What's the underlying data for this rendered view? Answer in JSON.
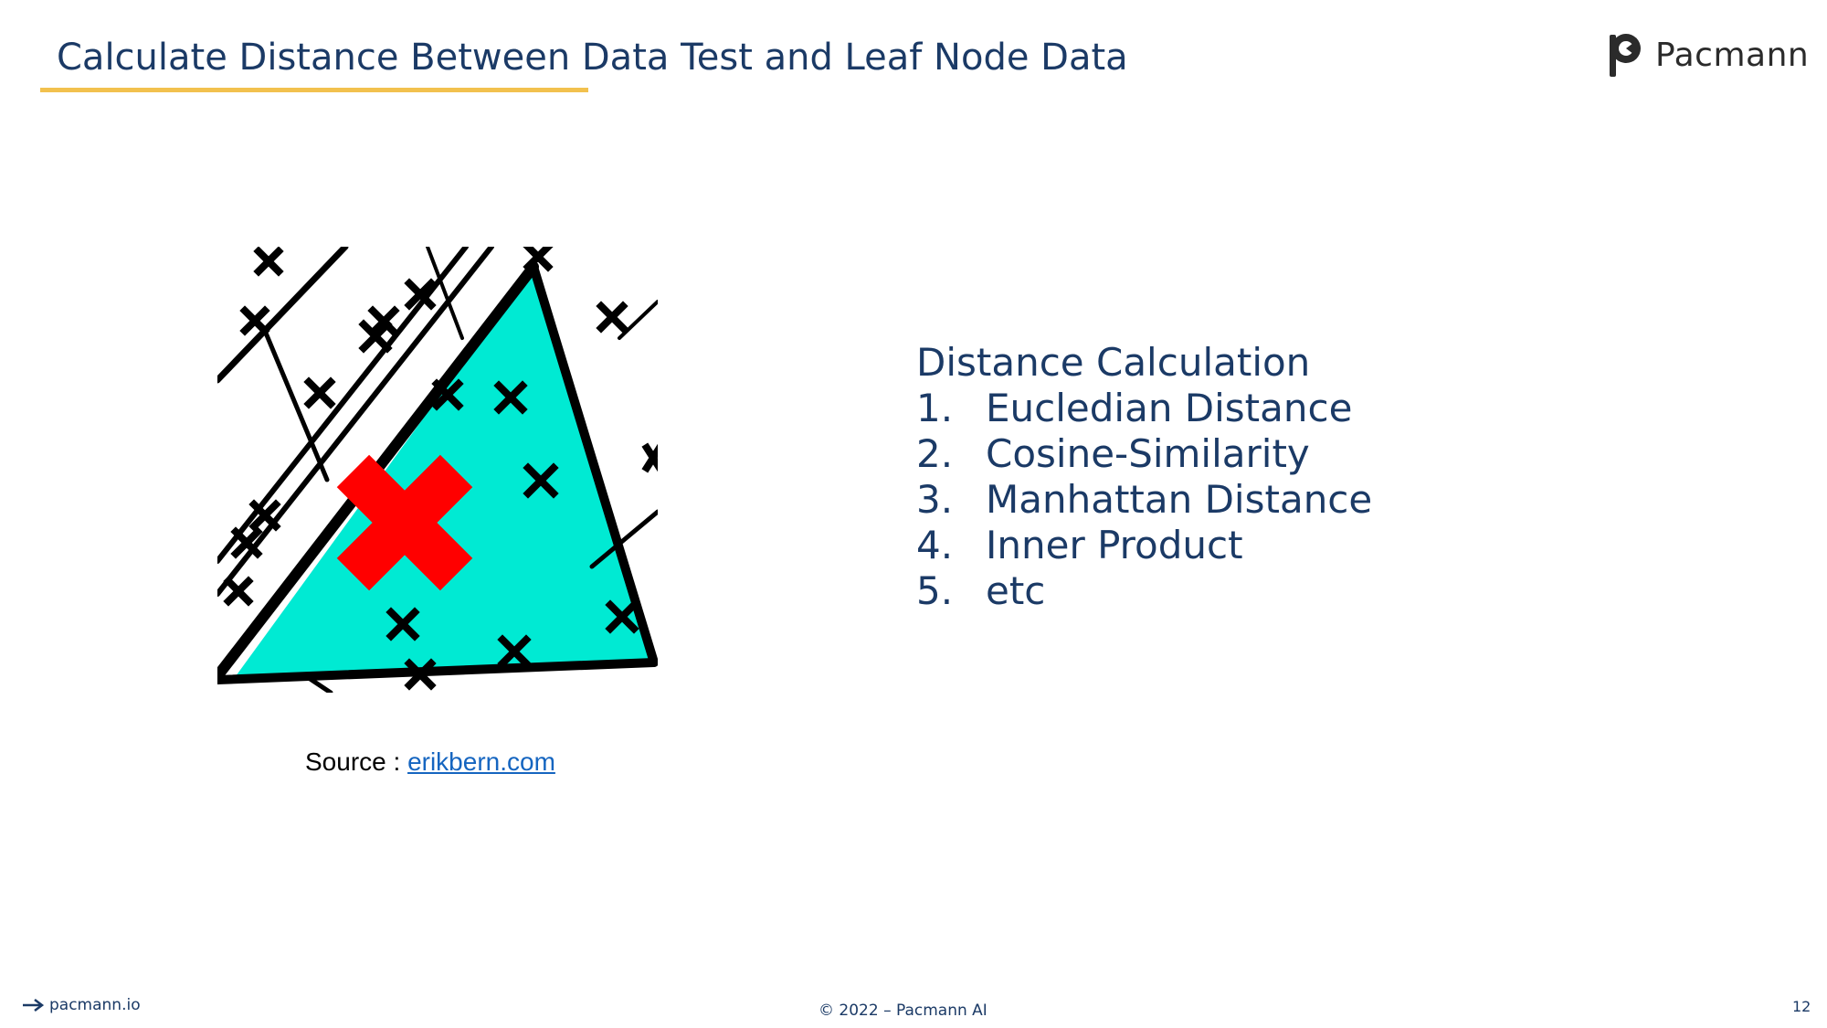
{
  "slide": {
    "title": "Calculate Distance Between Data Test and Leaf Node Data",
    "page_number": "12"
  },
  "brand": {
    "name": "Pacmann",
    "logo_icon": "pacmann-logo-icon"
  },
  "figure": {
    "caption_prefix": "Source : ",
    "caption_link": "erikbern.com",
    "colors": {
      "region": "#00ead3",
      "query_point": "#ff0000",
      "lines": "#000000"
    }
  },
  "content": {
    "heading": "Distance Calculation",
    "methods": [
      {
        "number": "1.",
        "label": "Eucledian Distance"
      },
      {
        "number": "2.",
        "label": "Cosine-Similarity"
      },
      {
        "number": "3.",
        "label": "Manhattan Distance"
      },
      {
        "number": "4.",
        "label": "Inner Product"
      },
      {
        "number": "5.",
        "label": "etc"
      }
    ]
  },
  "footer": {
    "link": "pacmann.io",
    "copyright": "© 2022 – Pacmann AI"
  },
  "colors": {
    "title": "#1b3a66",
    "accent": "#f2c14e",
    "link": "#1565c0"
  }
}
